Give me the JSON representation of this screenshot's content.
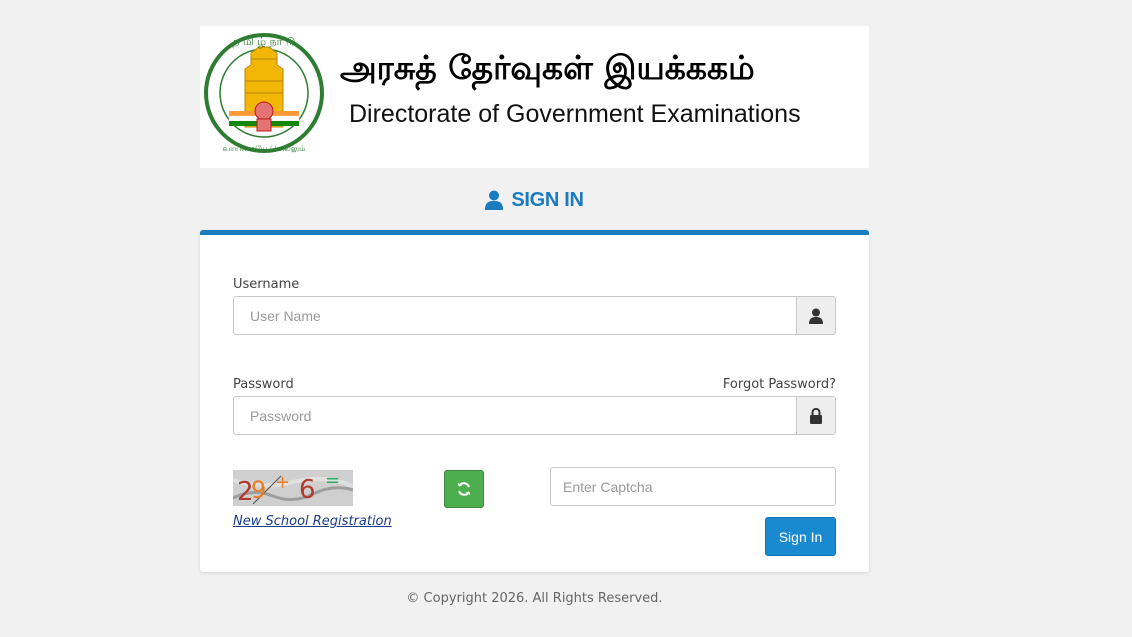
{
  "header": {
    "title_tamil": "அரசுத் தேர்வுகள் இயக்ககம்",
    "title_english": "Directorate of Government Examinations",
    "emblem_icon": "tamil-nadu-emblem-icon",
    "emblem_motto": "வாய்மையே வெல்லும்"
  },
  "signin": {
    "heading": "SIGN IN",
    "heading_icon": "user-icon"
  },
  "form": {
    "username_label": "Username",
    "username_placeholder": "User Name",
    "username_icon": "user-icon",
    "password_label": "Password",
    "password_placeholder": "Password",
    "password_icon": "lock-icon",
    "forgot_password": "Forgot Password?",
    "captcha_text": [
      "2",
      "9",
      "+",
      "6",
      "="
    ],
    "refresh_icon": "refresh-icon",
    "captcha_placeholder": "Enter Captcha",
    "new_school_link": "New School Registration",
    "signin_button": "Sign In"
  },
  "footer": {
    "copyright": "© Copyright 2026. All Rights Reserved."
  },
  "colors": {
    "accent": "#1a7bbf",
    "button_blue": "#1a8ad0",
    "refresh_green": "#4cae4c",
    "background": "#f1f1f1"
  }
}
